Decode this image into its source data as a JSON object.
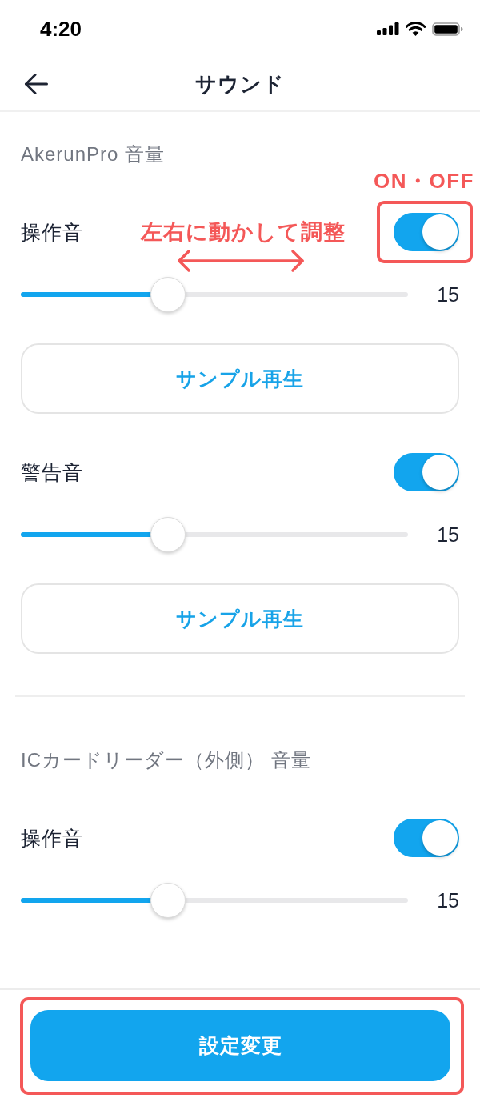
{
  "status_bar": {
    "time": "4:20"
  },
  "nav": {
    "title": "サウンド"
  },
  "sections": [
    {
      "title": "AkerunPro 音量",
      "items": [
        {
          "label": "操作音",
          "on": true,
          "level": 0.38,
          "reading": "15",
          "button": "サンプル再生",
          "toggle_note": "ON・OFF",
          "toggle_highlighted": true,
          "slider_note": "左右に動かして調整"
        },
        {
          "label": "警告音",
          "on": true,
          "level": 0.38,
          "reading": "15",
          "button": "サンプル再生",
          "toggle_highlighted": false
        }
      ]
    },
    {
      "title": "ICカードリーダー（外側） 音量",
      "items": [
        {
          "label": "操作音",
          "on": true,
          "level": 0.38,
          "reading": "15",
          "toggle_highlighted": false
        }
      ]
    }
  ],
  "footer": {
    "button": "設定変更",
    "highlighted": true
  }
}
